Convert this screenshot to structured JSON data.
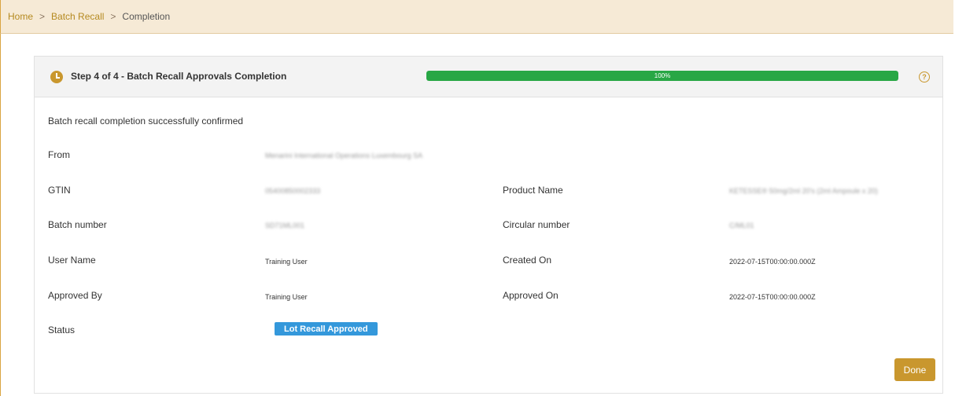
{
  "breadcrumb": {
    "home": "Home",
    "batch_recall": "Batch Recall",
    "current": "Completion",
    "separator": ">"
  },
  "step": {
    "title": "Step 4 of 4 - Batch Recall Approvals Completion",
    "progress_label": "100%",
    "progress_fraction": 1.0
  },
  "message": "Batch recall completion successfully confirmed",
  "fields": {
    "from": {
      "label": "From",
      "value": "Menarini International Operations Luxembourg SA"
    },
    "gtin": {
      "label": "GTIN",
      "value": "05400850002333"
    },
    "product_name": {
      "label": "Product Name",
      "value": "KETESSE® 50mg/2ml 20's (2ml Ampoule x 20)"
    },
    "batch_number": {
      "label": "Batch number",
      "value": "SD71ML001"
    },
    "circular_number": {
      "label": "Circular number",
      "value": "C/ML01"
    },
    "user_name": {
      "label": "User Name",
      "value": "Training User"
    },
    "created_on": {
      "label": "Created On",
      "value": "2022-07-15T00:00:00.000Z"
    },
    "approved_by": {
      "label": "Approved By",
      "value": "Training User"
    },
    "approved_on": {
      "label": "Approved On",
      "value": "2022-07-15T00:00:00.000Z"
    },
    "status": {
      "label": "Status",
      "value": "Lot Recall Approved"
    }
  },
  "actions": {
    "done": "Done"
  },
  "colors": {
    "accent": "#c9972e",
    "progress": "#28a745",
    "status_badge": "#3498db",
    "breadcrumb_bg": "#f6ead6"
  },
  "icons": {
    "step": "clock-icon",
    "help": "question-circle-icon",
    "help_glyph": "?"
  }
}
